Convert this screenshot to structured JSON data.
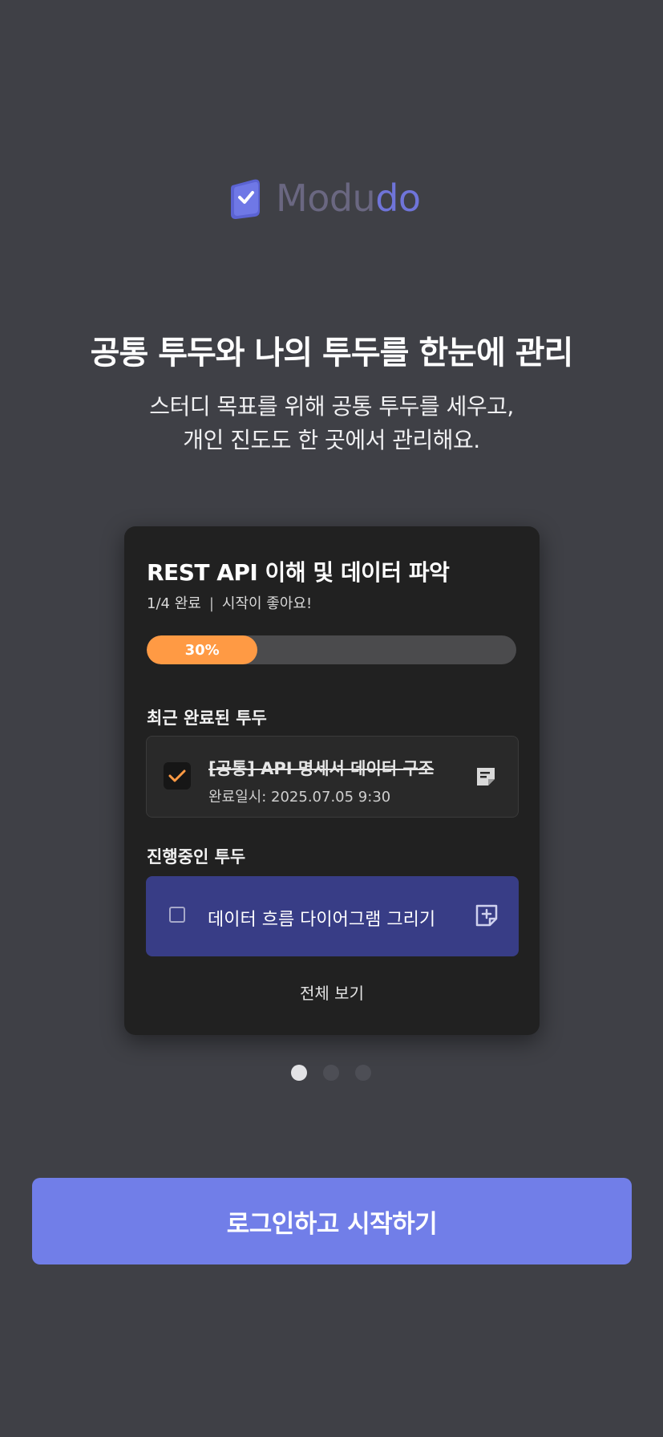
{
  "brand": {
    "logo_prefix": "Modu",
    "logo_suffix": "do",
    "logo_icon": "check-badge-icon"
  },
  "hero": {
    "headline": "공통 투두와 나의 투두를 한눈에 관리",
    "subline_1": "스터디 목표를 위해 공통 투두를 세우고,",
    "subline_2": "개인 진도도 한 곳에서 관리해요."
  },
  "card": {
    "title": "REST API 이해 및 데이터 파악",
    "count": "1/4 완료",
    "separator": "|",
    "status": "시작이 좋아요!",
    "progress_label": "30%",
    "progress_fraction": 0.3,
    "recent_done_label": "최근 완료된 투두",
    "done_item": {
      "title": "[공통] API 명세서 데이터 구조",
      "completed_at": "완료일시: 2025.07.05 9:30",
      "checked": true,
      "memo_icon": "memo-filled-icon"
    },
    "in_progress_label": "진행중인 투두",
    "progress_item": {
      "title": "데이터 흐름 다이어그램 그리기",
      "checked": false,
      "memo_icon": "memo-add-icon"
    },
    "view_all": "전체 보기"
  },
  "pager": {
    "count": 3,
    "active_index": 0
  },
  "cta": {
    "label": "로그인하고 시작하기"
  },
  "colors": {
    "background": "#3f4046",
    "card": "#212121",
    "accent": "#717ee8",
    "progress": "#ff9a44",
    "in_progress_item": "#383d86"
  }
}
